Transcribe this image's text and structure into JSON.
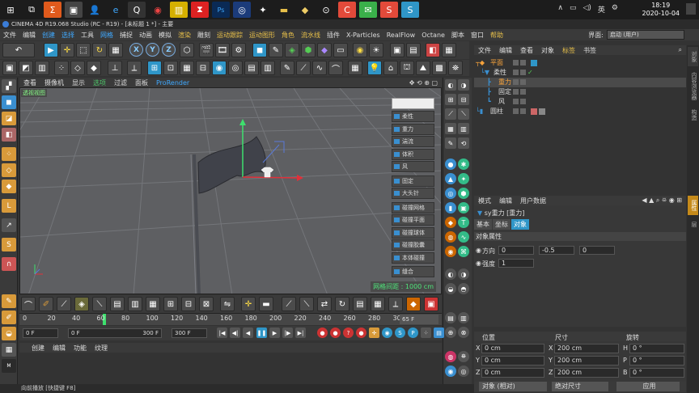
{
  "taskbar": {
    "clock_time": "18:19",
    "clock_date": "2020-10-04",
    "tray_lang": "英"
  },
  "window": {
    "title": "CINEMA 4D R19.068 Studio (RC - R19) - [未标题 1 *] - 主要"
  },
  "menu": {
    "items": [
      "文件",
      "编辑",
      "创建",
      "选择",
      "工具",
      "网格",
      "捕捉",
      "动画",
      "模拟",
      "渲染",
      "雕刻",
      "运动跟踪",
      "运动图形",
      "角色",
      "流水线",
      "插件",
      "X-Particles",
      "RealFlow",
      "Octane",
      "脚本",
      "窗口",
      "帮助"
    ],
    "layout_label": "界面:",
    "layout_value": "启动 (用户)"
  },
  "toolbar": {
    "x_label": "X",
    "y_label": "Y",
    "z_label": "Z"
  },
  "viewport": {
    "menu": [
      "查看",
      "摄像机",
      "显示",
      "选项",
      "过滤",
      "面板",
      "ProRender"
    ],
    "view_name": "透视视图",
    "grid_spacing": "网格间距 : 1000 cm",
    "cloth_tags": [
      "柔性",
      "重力",
      "湍流",
      "体积",
      "风",
      "固定",
      "大头针",
      "碰撞网格",
      "碰撞平面",
      "碰撞球体",
      "碰撞胶囊",
      "本体碰撞",
      "缝合"
    ]
  },
  "timeline": {
    "ticks": [
      "0",
      "20",
      "40",
      "60",
      "80",
      "100",
      "120",
      "140",
      "160",
      "180",
      "200",
      "220",
      "240",
      "260",
      "280",
      "30"
    ],
    "current_frame": 65,
    "frame_display": "65 F",
    "start_field": "0 F",
    "preview_start": "0 F",
    "preview_end": "300 F",
    "end_field": "300 F"
  },
  "materials": {
    "menu": [
      "创建",
      "编辑",
      "功能",
      "纹理"
    ]
  },
  "object_manager": {
    "menu": [
      "文件",
      "编辑",
      "查看",
      "对象",
      "标签",
      "书签"
    ],
    "objects": [
      {
        "name": "平面",
        "indent": 0
      },
      {
        "name": "柔性",
        "indent": 1
      },
      {
        "name": "重力",
        "indent": 2
      },
      {
        "name": "固定",
        "indent": 2
      },
      {
        "name": "风",
        "indent": 2
      },
      {
        "name": "圆柱",
        "indent": 0
      }
    ]
  },
  "attribute_manager": {
    "menu": [
      "模式",
      "编辑",
      "用户数据"
    ],
    "title": "sy重力 [重力]",
    "tabs": [
      "基本",
      "坐标",
      "对象"
    ],
    "active_tab": "对象",
    "section": "对象属性",
    "direction_label": "方向",
    "direction": [
      "0",
      "-0.5",
      "0"
    ],
    "strength_label": "强度",
    "strength": "1"
  },
  "coordinates": {
    "headers": [
      "位置",
      "尺寸",
      "旋转"
    ],
    "rows": [
      {
        "axis": "X",
        "pos": "0 cm",
        "size_axis": "X",
        "size": "200 cm",
        "rot_axis": "H",
        "rot": "0 °"
      },
      {
        "axis": "Y",
        "pos": "0 cm",
        "size_axis": "Y",
        "size": "200 cm",
        "rot_axis": "P",
        "rot": "0 °"
      },
      {
        "axis": "Z",
        "pos": "0 cm",
        "size_axis": "Z",
        "size": "200 cm",
        "rot_axis": "B",
        "rot": "0 °"
      }
    ],
    "mode_object": "对象 (相对)",
    "mode_size": "绝对尺寸",
    "apply": "应用"
  },
  "side_tabs": [
    "对象",
    "内容浏览器",
    "构造",
    "属性",
    "层"
  ],
  "status": {
    "text": "向前播放 [快捷键 F8]"
  }
}
